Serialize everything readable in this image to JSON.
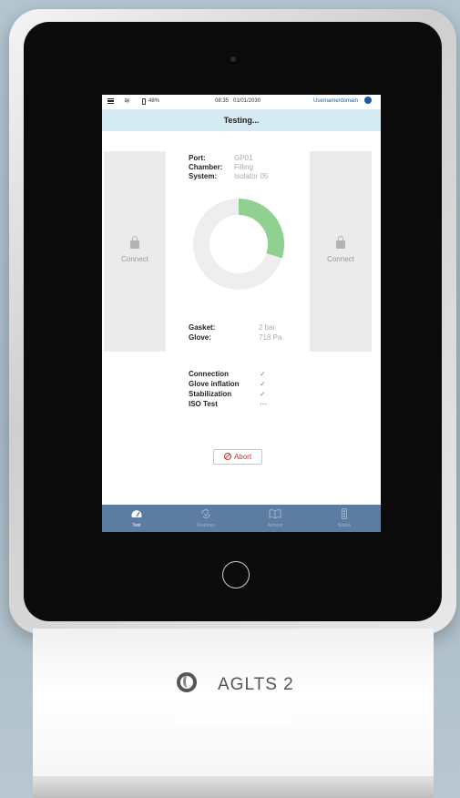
{
  "statusbar": {
    "battery": "48%",
    "time": "08:35",
    "date": "01/01/2030",
    "user": "Username/domain"
  },
  "title": "Testing...",
  "left_panel": {
    "label": "Connect"
  },
  "right_panel": {
    "label": "Connect"
  },
  "info_top": [
    {
      "label": "Port:",
      "value": "GP01"
    },
    {
      "label": "Chamber:",
      "value": "Filling"
    },
    {
      "label": "System:",
      "value": "Isolator 05"
    }
  ],
  "progress": {
    "fraction": 0.3,
    "fill_color": "#90d090",
    "track_color": "#eeeeee"
  },
  "info_bottom": [
    {
      "label": "Gasket:",
      "value": "2 bar"
    },
    {
      "label": "Glove:",
      "value": "718 Pa"
    }
  ],
  "steps": [
    {
      "name": "Connection",
      "status": "✓"
    },
    {
      "name": "Glove inflation",
      "status": "✓"
    },
    {
      "name": "Stabilization",
      "status": "✓"
    },
    {
      "name": "ISO Test",
      "status": "···"
    }
  ],
  "abort_label": "Abort",
  "nav": [
    {
      "label": "Test",
      "icon": "gauge-icon",
      "active": true
    },
    {
      "label": "Routines",
      "icon": "routines-icon",
      "active": false
    },
    {
      "label": "Archive",
      "icon": "book-icon",
      "active": false
    },
    {
      "label": "Status",
      "icon": "traffic-light-icon",
      "active": false
    }
  ],
  "dock_brand": "AGLTS 2",
  "colors": {
    "accent": "#5c7da1",
    "title_bg": "#d6eaf4",
    "abort": "#d32f2f",
    "check": "#43a047"
  }
}
